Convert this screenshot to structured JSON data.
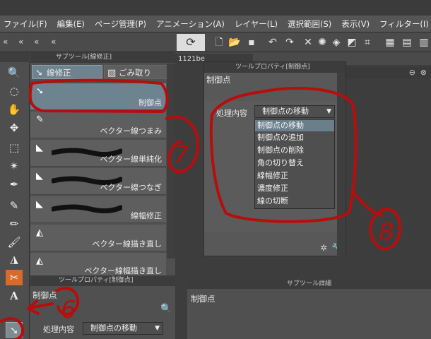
{
  "menu": [
    "ファイル(F)",
    "編集(E)",
    "ページ管理(P)",
    "アニメーション(A)",
    "レイヤー(L)",
    "選択範囲(S)",
    "表示(V)",
    "フィルター(I)"
  ],
  "subtool": {
    "header": "サブツール[線修正]",
    "tabs": [
      "線修正",
      "ごみ取り"
    ],
    "items": [
      "制御点",
      "ベクター線つまみ",
      "ベクター線単純化",
      "ベクター線つなぎ",
      "線幅修正",
      "ベクター線描き直し",
      "ベクター線幅描き直し"
    ]
  },
  "document": {
    "tab_label": "1121be"
  },
  "tool_property": {
    "header": "ツールプロパティ[制御点]",
    "title": "制御点",
    "label": "処理内容",
    "selected": "制御点の移動",
    "options": [
      "制御点の移動",
      "制御点の追加",
      "制御点の削除",
      "角の切り替え",
      "線幅修正",
      "濃度修正",
      "線の切断"
    ]
  },
  "lower_property": {
    "header": "ツールプロパティ[制御点]",
    "title": "制御点",
    "label": "処理内容",
    "selected": "制御点の移動"
  },
  "detail": {
    "header": "サブツール詳細",
    "title": "制御点"
  },
  "annotations": {
    "num_6": "6",
    "num_7": "7",
    "num_8": "8"
  },
  "colors": {
    "annotation": "#b80d0d",
    "selected": "#6d8390"
  }
}
